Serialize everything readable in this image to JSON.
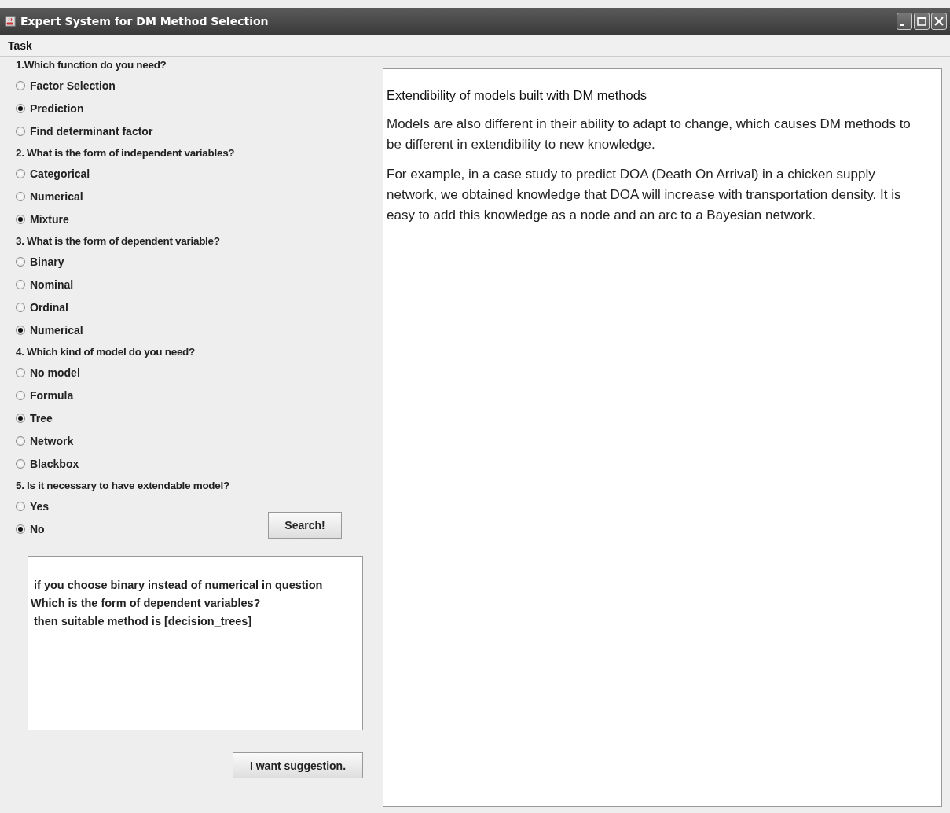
{
  "window": {
    "title": "Expert System for DM Method Selection"
  },
  "menu": [
    "Task"
  ],
  "questions": [
    {
      "text": "1.Which function do you need?",
      "options": [
        {
          "label": "Factor Selection",
          "selected": false
        },
        {
          "label": "Prediction",
          "selected": true
        },
        {
          "label": "Find determinant factor",
          "selected": false
        }
      ]
    },
    {
      "text": "2. What is the form of independent variables?",
      "options": [
        {
          "label": "Categorical",
          "selected": false
        },
        {
          "label": "Numerical",
          "selected": false
        },
        {
          "label": "Mixture",
          "selected": true
        }
      ]
    },
    {
      "text": "3. What is the form of dependent variable?",
      "options": [
        {
          "label": "Binary",
          "selected": false
        },
        {
          "label": "Nominal",
          "selected": false
        },
        {
          "label": "Ordinal",
          "selected": false
        },
        {
          "label": "Numerical",
          "selected": true
        }
      ]
    },
    {
      "text": "4. Which kind of model do you need?",
      "options": [
        {
          "label": "No model",
          "selected": false
        },
        {
          "label": "Formula",
          "selected": false
        },
        {
          "label": "Tree",
          "selected": true
        },
        {
          "label": "Network",
          "selected": false
        },
        {
          "label": "Blackbox",
          "selected": false
        }
      ]
    },
    {
      "text": "5. Is it necessary to have extendable model?",
      "options": [
        {
          "label": "Yes",
          "selected": false
        },
        {
          "label": "No",
          "selected": true
        }
      ]
    }
  ],
  "search_button": "Search!",
  "output_lines": [
    " if you choose binary instead of numerical in question",
    "Which is the form of dependent variables?",
    " then suitable method is [decision_trees]"
  ],
  "suggestion_button": "I want suggestion.",
  "info": {
    "heading": "Extendibility of models built with DM methods",
    "paragraphs": [
      "Models are also different in their ability to adapt to change, which causes DM methods to be different in extendibility to new knowledge.",
      "For example, in a case study to predict DOA (Death On Arrival) in a chicken supply network, we obtained knowledge that DOA will increase with transportation density. It is easy to add this knowledge as a node and an arc to a Bayesian network."
    ]
  }
}
